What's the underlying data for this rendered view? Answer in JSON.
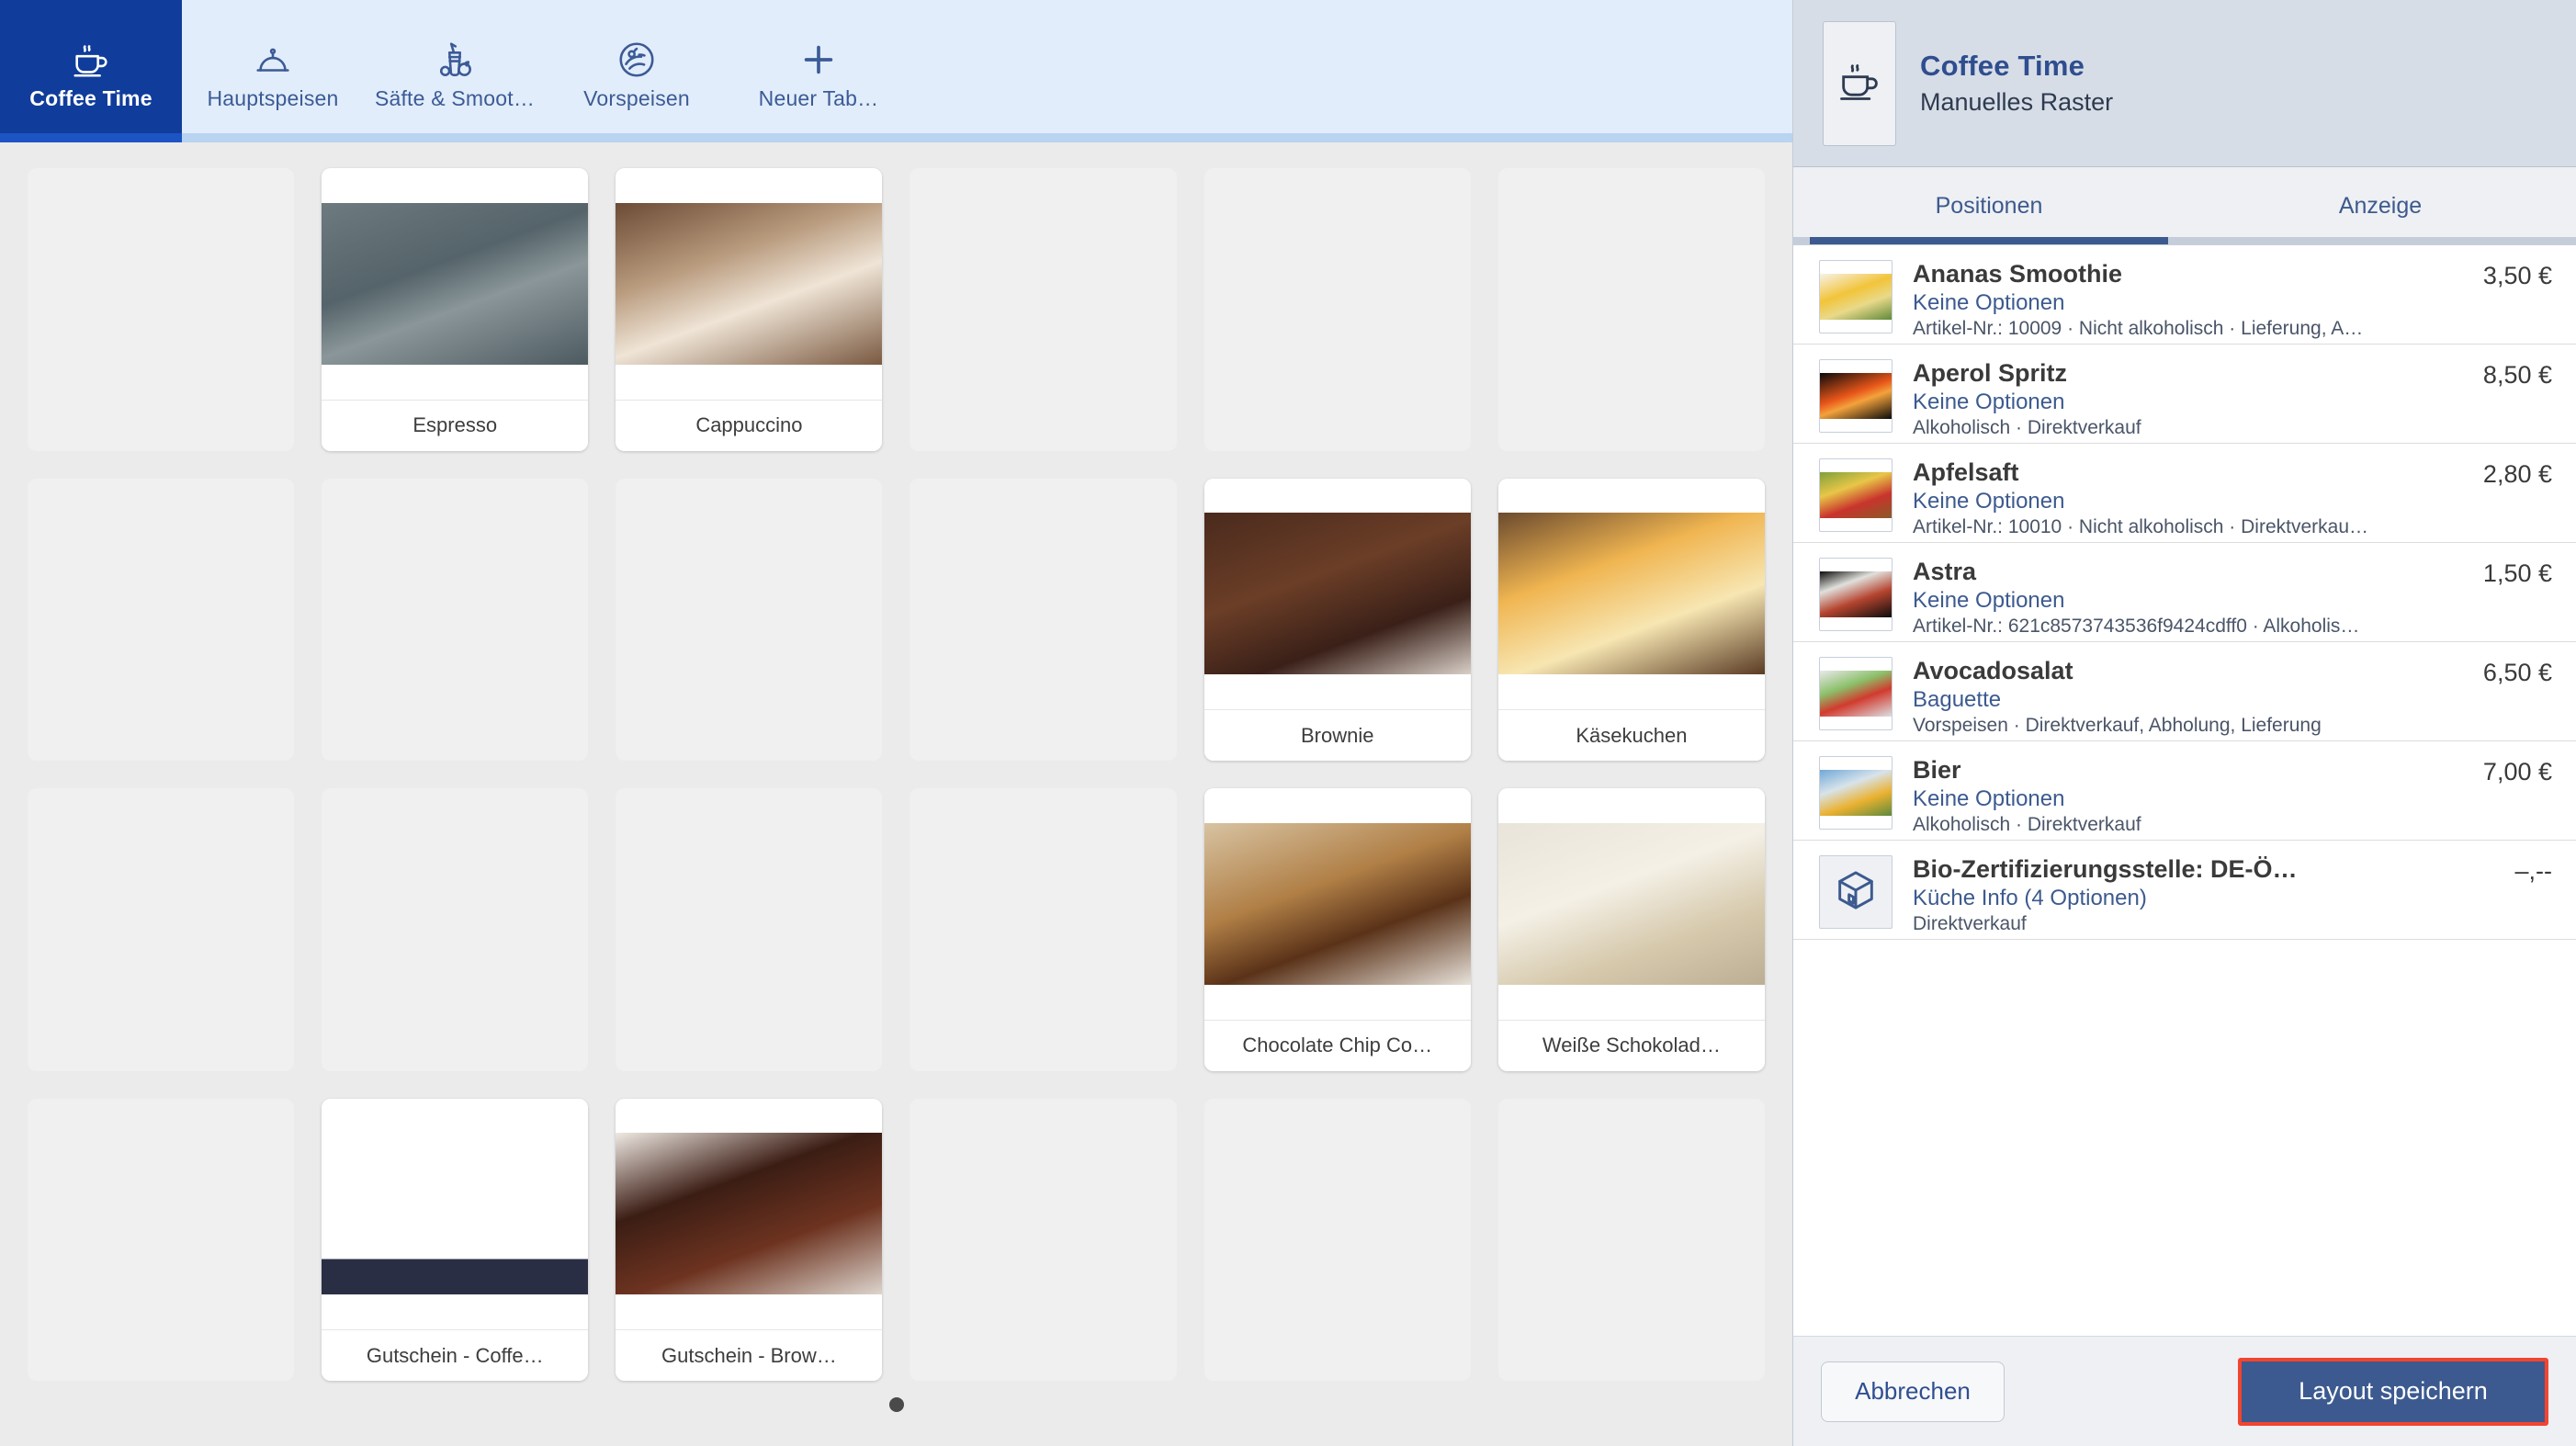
{
  "tabs": [
    {
      "label": "Coffee Time",
      "icon": "coffee-cup-icon",
      "active": true
    },
    {
      "label": "Hauptspeisen",
      "icon": "food-cloche-icon",
      "active": false
    },
    {
      "label": "Säfte & Smoot…",
      "icon": "juice-cup-icon",
      "active": false
    },
    {
      "label": "Vorspeisen",
      "icon": "salad-plate-icon",
      "active": false
    },
    {
      "label": "Neuer Tab…",
      "icon": "plus-icon",
      "active": false
    }
  ],
  "grid": {
    "columns": 6,
    "rows": 4,
    "cells": [
      {
        "empty": true
      },
      {
        "empty": false,
        "label": "Espresso",
        "image": "ph-espresso"
      },
      {
        "empty": false,
        "label": "Cappuccino",
        "image": "ph-cappuccino"
      },
      {
        "empty": true
      },
      {
        "empty": true
      },
      {
        "empty": true
      },
      {
        "empty": true
      },
      {
        "empty": true
      },
      {
        "empty": true
      },
      {
        "empty": true
      },
      {
        "empty": false,
        "label": "Brownie",
        "image": "ph-brownie"
      },
      {
        "empty": false,
        "label": "Käsekuchen",
        "image": "ph-cheesecake"
      },
      {
        "empty": true
      },
      {
        "empty": true
      },
      {
        "empty": true
      },
      {
        "empty": true
      },
      {
        "empty": false,
        "label": "Chocolate Chip Co…",
        "image": "ph-cookie"
      },
      {
        "empty": false,
        "label": "Weiße Schokolad…",
        "image": "ph-whitechoc"
      },
      {
        "empty": true
      },
      {
        "empty": false,
        "label": "Gutschein - Coffe…",
        "image": "ph-coffeelogo"
      },
      {
        "empty": false,
        "label": "Gutschein - Brow…",
        "image": "ph-gutbrownie"
      },
      {
        "empty": true
      },
      {
        "empty": true
      },
      {
        "empty": true
      }
    ],
    "pagination": {
      "pages": 1,
      "current": 1
    }
  },
  "panel": {
    "title": "Coffee Time",
    "subtitle": "Manuelles Raster",
    "icon": "coffee-cup-icon",
    "tabs": [
      {
        "label": "Positionen",
        "active": true
      },
      {
        "label": "Anzeige",
        "active": false
      }
    ],
    "items": [
      {
        "name": "Ananas Smoothie",
        "price": "3,50 €",
        "options": "Keine Optionen",
        "meta": "Artikel-Nr.: 10009 · Nicht alkoholisch · Lieferung, A…",
        "image": "ph-smoothie",
        "thumb_type": "photo"
      },
      {
        "name": "Aperol Spritz",
        "price": "8,50 €",
        "options": "Keine Optionen",
        "meta": "Alkoholisch · Direktverkauf",
        "image": "ph-aperol",
        "thumb_type": "photo"
      },
      {
        "name": "Apfelsaft",
        "price": "2,80 €",
        "options": "Keine Optionen",
        "meta": "Artikel-Nr.: 10010 · Nicht alkoholisch · Direktverkau…",
        "image": "ph-apfelsaft",
        "thumb_type": "photo"
      },
      {
        "name": "Astra",
        "price": "1,50 €",
        "options": "Keine Optionen",
        "meta": "Artikel-Nr.: 621c8573743536f9424cdff0 · Alkoholis…",
        "image": "ph-astra",
        "thumb_type": "photo"
      },
      {
        "name": "Avocadosalat",
        "price": "6,50 €",
        "options": "Baguette",
        "meta": "Vorspeisen · Direktverkauf, Abholung, Lieferung",
        "image": "ph-avocado",
        "thumb_type": "photo"
      },
      {
        "name": "Bier",
        "price": "7,00 €",
        "options": "Keine Optionen",
        "meta": "Alkoholisch · Direktverkauf",
        "image": "ph-bier",
        "thumb_type": "photo"
      },
      {
        "name": "Bio-Zertifizierungsstelle: DE-Ö…",
        "price": "–,--",
        "options": "Küche Info (4 Optionen)",
        "meta": "Direktverkauf",
        "image": "",
        "thumb_type": "box-icon"
      }
    ],
    "footer": {
      "cancel_label": "Abbrechen",
      "save_label": "Layout speichern"
    }
  },
  "colors": {
    "active_tab_bg": "#103d9b",
    "tab_bar_bg": "#e1edfa",
    "panel_header_bg": "#d7dde6",
    "accent_blue": "#3c5a8f",
    "save_highlight": "#f4442e",
    "grid_bg": "#ebebeb",
    "empty_cell": "#f0f0f0"
  }
}
